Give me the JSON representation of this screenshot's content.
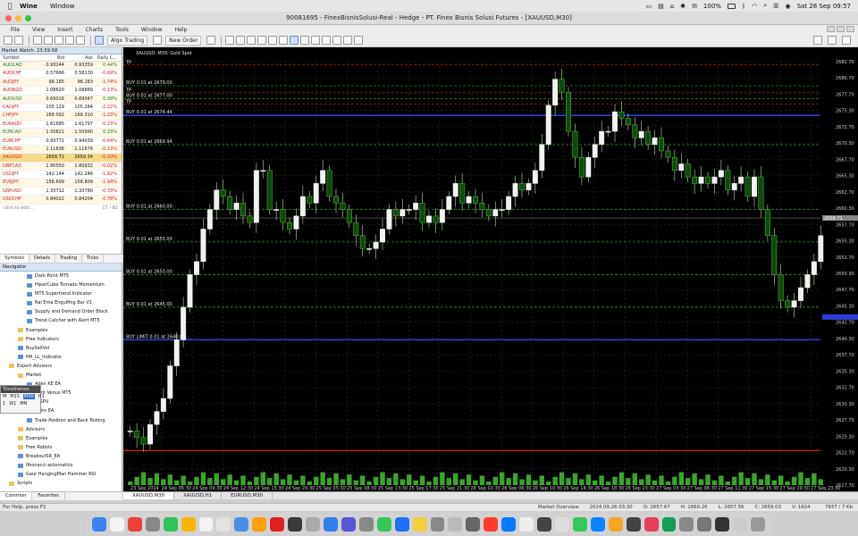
{
  "mac": {
    "app": "Wine",
    "menu": "Window",
    "battery": "100%",
    "clock": "Sat 28 Sep  09:57"
  },
  "window": {
    "title": "90081695 - FinexBisnisSolusi-Real - Hedge - PT. Finex Bisnis Solusi Futures - [XAUUSD,M30]"
  },
  "appmenu": [
    "File",
    "View",
    "Insert",
    "Charts",
    "Tools",
    "Window",
    "Help"
  ],
  "toolbar": {
    "algo": "Algo Trading",
    "neworder": "New Order"
  },
  "mw": {
    "title": "Market Watch: 23:59:58",
    "cols": [
      "Symbol",
      "Bid",
      "Ask",
      "Daily C..."
    ],
    "rows": [
      [
        "AUDCAD",
        "0.93244",
        "0.93359",
        "0.44%",
        "up"
      ],
      [
        "AUDCHF",
        "0.57666",
        "0.58130",
        "-0.69%",
        "dn"
      ],
      [
        "AUDJPY",
        "98.185",
        "98.283",
        "-1.74%",
        "dn"
      ],
      [
        "AUDNZD",
        "1.08620",
        "1.08889",
        "-0.13%",
        "dn"
      ],
      [
        "AUDUSD",
        "0.69016",
        "0.69047",
        "0.08%",
        "up"
      ],
      [
        "CADJPY",
        "105.129",
        "105.284",
        "-2.22%",
        "dn"
      ],
      [
        "CHFJPY",
        "168.092",
        "169.310",
        "-1.23%",
        "dn"
      ],
      [
        "EURAUD",
        "1.61685",
        "1.61797",
        "-0.23%",
        "dn"
      ],
      [
        "EURCAD",
        "1.50821",
        "1.50990",
        "0.23%",
        "up"
      ],
      [
        "EURCHF",
        "0.93772",
        "0.94039",
        "-0.64%",
        "dn"
      ],
      [
        "EURUSD",
        "1.11636",
        "1.11676",
        "-0.13%",
        "dn"
      ],
      [
        "XAUUSD",
        "2658.71",
        "2659.34",
        "-0.50%",
        "dn"
      ],
      [
        "GBPCAD",
        "1.80550",
        "1.80932",
        "-0.02%",
        "dn"
      ],
      [
        "USDJPY",
        "142.144",
        "142.246",
        "-1.82%",
        "dn"
      ],
      [
        "EURJPY",
        "158.699",
        "158.809",
        "-1.94%",
        "dn"
      ],
      [
        "GBPUSD",
        "1.33712",
        "1.33780",
        "-0.33%",
        "dn"
      ],
      [
        "USDCHF",
        "0.84022",
        "0.84204",
        "-0.78%",
        "dn"
      ]
    ],
    "add": "click to add...",
    "count": "17 / 82",
    "tabs": [
      "Symbols",
      "Details",
      "Trading",
      "Ticks"
    ]
  },
  "nav": {
    "title": "Navigator",
    "items": [
      [
        "Dark Point MT5",
        3,
        "ind"
      ],
      [
        "HiperCube Tornado Momentum",
        3,
        "ind"
      ],
      [
        "MT5 Supertrend Indicator",
        3,
        "ind"
      ],
      [
        "Rai Ema Engulfing Bar V1",
        3,
        "ind"
      ],
      [
        "Supply and Demand Order Block",
        3,
        "ind"
      ],
      [
        "Trend Catcher with Alert MT5",
        3,
        "ind"
      ],
      [
        "Examples",
        2,
        "fold"
      ],
      [
        "Free Indicators",
        2,
        "fold"
      ],
      [
        "BuySellVol",
        2,
        "ind"
      ],
      [
        "HH_LL_Indicator",
        2,
        "ind"
      ],
      [
        "Expert Advisors",
        1,
        "fold"
      ],
      [
        "Market",
        2,
        "fold"
      ],
      [
        "Aden KE EA",
        3,
        "ind"
      ],
      [
        "Dark Venus MT5",
        3,
        "ind"
      ],
      [
        "d GPU",
        3,
        "ind"
      ],
      [
        "e Bro EA",
        3,
        "ind"
      ],
      [
        "Trade Position and Back Testing",
        3,
        "ind"
      ],
      [
        "Advisors",
        2,
        "fold"
      ],
      [
        "Examples",
        2,
        "fold"
      ],
      [
        "Free Robots",
        2,
        "fold"
      ],
      [
        "BreakoutSR_EA",
        2,
        "ind"
      ],
      [
        "fibonacci automatico",
        2,
        "ind"
      ],
      [
        "Gaur HangingMan Hammer RSI",
        2,
        "ind"
      ],
      [
        "Scripts",
        1,
        "fold"
      ]
    ],
    "tabs": [
      "Common",
      "Favorites"
    ]
  },
  "tf": {
    "title": "Timeframes",
    "row1": [
      "M",
      "M15",
      "M30",
      "H1"
    ],
    "row2": [
      "1",
      "W1",
      "MN"
    ]
  },
  "chart": {
    "label": "XAUUSD, M30:  Gold Spot",
    "ticks": [
      "2682.70",
      "2680.70",
      "2677.70",
      "2675.30",
      "2672.70",
      "2670.30",
      "2667.70",
      "2665.30",
      "2662.70",
      "2660.30",
      "2657.70",
      "2655.30",
      "2652.70",
      "2650.30",
      "2647.70",
      "2645.30",
      "2642.70",
      "2640.30",
      "2637.70",
      "2635.30",
      "2632.70",
      "2630.30",
      "2627.70",
      "2625.30",
      "2622.70",
      "2620.30",
      "2617.70"
    ],
    "times": [
      "23 Sep 2024",
      "24 Sep 06:30",
      "24 Sep 09:30",
      "24 Sep 12:30",
      "24 Sep 15:30",
      "24 Sep 20:30",
      "25 Sep 05:30",
      "25 Sep 08:30",
      "25 Sep 13:30",
      "25 Sep 17:30",
      "25 Sep 21:30",
      "26 Sep 02:30",
      "26 Sep 06:30",
      "26 Sep 10:30",
      "26 Sep 14:30",
      "26 Sep 18:30",
      "26 Sep 23:30",
      "27 Sep 03:30",
      "27 Sep 06:30",
      "27 Sep 11:30",
      "27 Sep 15:30",
      "27 Sep 19:30",
      "27 Sep 23:30"
    ],
    "tp": [
      "TP",
      "TP",
      "TP"
    ],
    "orders": [
      "BUY 0.01 at 2679.00",
      "BUY 0.01 at 2677.00",
      "BUY 0.01 at 2674.44",
      "BUY 0.01 at 2669.94",
      "BUY 0.01 at 2660.00",
      "BUY 0.01 at 2655.00",
      "BUY 0.01 at 2650.00",
      "BUY 0.01 at 2645.00",
      "BUY LIMIT 0.01 at 2640.00"
    ],
    "price": "2658.71"
  },
  "ctabs": [
    "XAUUSD,M30",
    "XAUUSD,H1",
    "EURUSD,M30"
  ],
  "status": {
    "help": "For Help, press F1",
    "overview": "Market Overview",
    "time": "2024.09.26 03:30",
    "o": "O: 2657.67",
    "h": "H: 2660.26",
    "l": "L: 2657.56",
    "c": "C: 2659.03",
    "v": "V: 1624",
    "kb": "7937 / 7 Kb"
  }
}
